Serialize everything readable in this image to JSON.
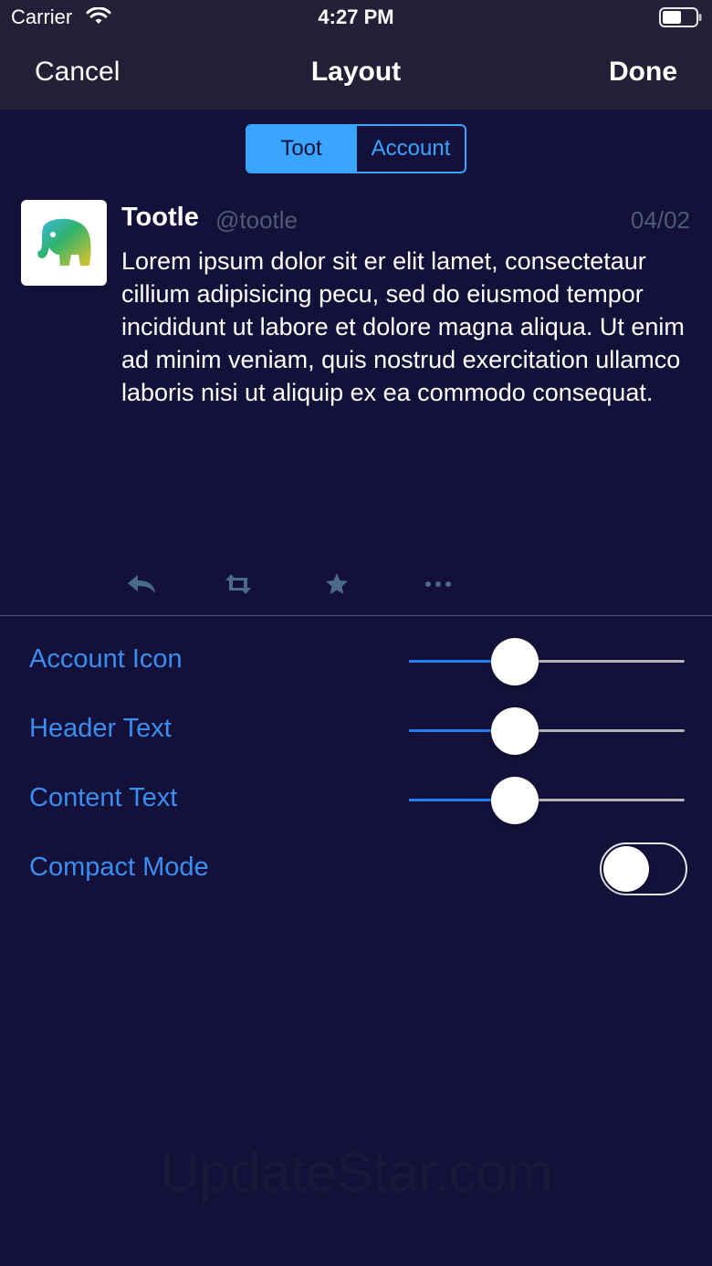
{
  "status_bar": {
    "carrier": "Carrier",
    "time": "4:27 PM",
    "wifi_icon": "wifi-icon",
    "battery_icon": "battery-icon"
  },
  "nav": {
    "cancel_label": "Cancel",
    "title": "Layout",
    "done_label": "Done"
  },
  "segments": [
    {
      "label": "Toot",
      "selected": true
    },
    {
      "label": "Account",
      "selected": false
    }
  ],
  "toot": {
    "avatar_icon": "elephant-avatar-icon",
    "display_name": "Tootle",
    "handle": "@tootle",
    "date": "04/02",
    "content": "Lorem ipsum dolor sit er elit lamet, consectetaur cillium adipisicing pecu, sed do eiusmod tempor incididunt ut labore et dolore magna aliqua. Ut enim ad minim veniam, quis nostrud exercitation ullamco laboris nisi ut aliquip ex ea commodo consequat.",
    "actions": [
      "reply-icon",
      "boost-icon",
      "favorite-icon",
      "more-icon"
    ]
  },
  "settings": [
    {
      "label": "Account Icon",
      "type": "slider",
      "value": 0.36
    },
    {
      "label": "Header Text",
      "type": "slider",
      "value": 0.36
    },
    {
      "label": "Content Text",
      "type": "slider",
      "value": 0.36
    },
    {
      "label": "Compact Mode",
      "type": "toggle",
      "on": false
    }
  ],
  "watermark": "UpdateStar.com",
  "colors": {
    "background": "#13113a",
    "bar": "#221f37",
    "accent": "#3aa5ff",
    "setting_label": "#3a8ef0",
    "slider_fill": "#1f7ff3",
    "muted": "#4f5a78"
  }
}
